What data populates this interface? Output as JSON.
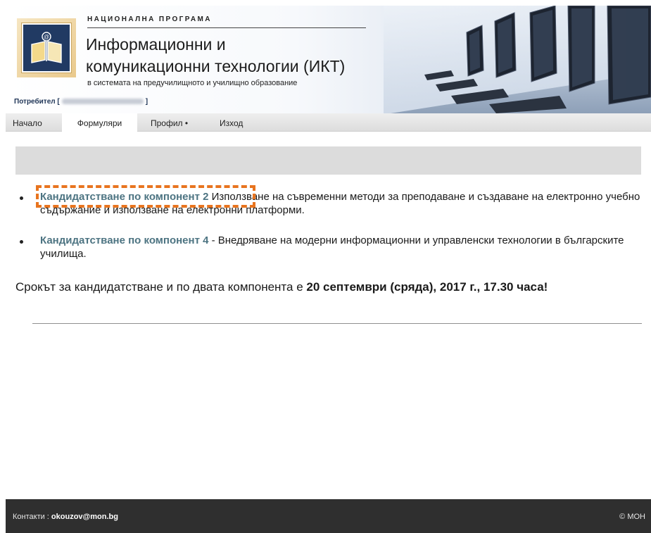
{
  "header": {
    "program_label": "НАЦИОНАЛНА ПРОГРАМА",
    "title_line1": "Информационни и",
    "title_line2": "комуникационни технологии (ИКТ)",
    "subtitle": "в системата на предучилищното и училищно образование",
    "user_label": "Потребител [",
    "user_close": "]",
    "logo_icon": "open-book-at-icon"
  },
  "nav": {
    "items": [
      {
        "label": "Начало"
      },
      {
        "label": "Формуляри"
      },
      {
        "label": "Профил •"
      },
      {
        "label": "Изход"
      }
    ],
    "active": "Формуляри"
  },
  "main": {
    "items": [
      {
        "link": "Кандидатстване по компонент 2",
        "text": " Използване на съвременни методи за преподаване и създаване на електронно учебно съдържание и използване на електронни платформи."
      },
      {
        "link": "Кандидатстване по компонент 4",
        "text": " - Внедряване на модерни информационни и управленски технологии в българските училища."
      }
    ],
    "deadline_prefix": "Срокът за кандидатстване и по двата компонента е ",
    "deadline_bold": "20 септември (сряда), 2017 г., 17.30 часа!"
  },
  "footer": {
    "contact_label": "Контакти : ",
    "contact_email": "okouzov@mon.bg",
    "copyright": "© МОН"
  },
  "colors": {
    "link": "#4d7482",
    "highlight": "#e8741f",
    "footer_bg": "#2f2f2f",
    "banner_grey": "#dcdcdc"
  }
}
